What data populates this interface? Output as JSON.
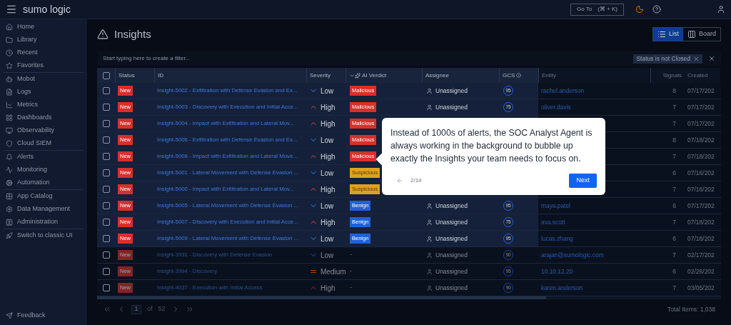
{
  "topbar": {
    "logo": "sumo logic",
    "goto_label": "Go To",
    "goto_shortcut": "(⌘ + K)"
  },
  "sidebar": {
    "groups": [
      [
        {
          "label": "Home"
        },
        {
          "label": "Library"
        },
        {
          "label": "Recent"
        },
        {
          "label": "Favorites"
        }
      ],
      [
        {
          "label": "Mobot"
        },
        {
          "label": "Logs"
        },
        {
          "label": "Metrics"
        },
        {
          "label": "Dashboards"
        },
        {
          "label": "Observability"
        },
        {
          "label": "Cloud SIEM"
        }
      ],
      [
        {
          "label": "Alerts"
        },
        {
          "label": "Monitoring"
        },
        {
          "label": "Automation"
        }
      ],
      [
        {
          "label": "App Catalog"
        },
        {
          "label": "Data Management"
        },
        {
          "label": "Administration"
        }
      ],
      [
        {
          "label": "Switch to classic UI"
        }
      ]
    ],
    "feedback": "Feedback"
  },
  "page": {
    "title": "Insights",
    "views": [
      {
        "label": "List",
        "selected": true
      },
      {
        "label": "Board",
        "selected": false
      }
    ]
  },
  "filter": {
    "placeholder": "Start typing here to create a filter...",
    "chips": [
      "Status is not Closed"
    ]
  },
  "table": {
    "select_all": {
      "checked": false
    },
    "columns": [
      "Status",
      "ID",
      "Severity",
      "AI Verdict",
      "Assignee",
      "GCS",
      "Entity",
      "Signals",
      "Created"
    ],
    "rows": [
      {
        "checked": false,
        "dimmed": false,
        "status": "New",
        "id": "Insight-5002 - Exfiltration with Defense Evasion and Ex...",
        "severity": {
          "kind": "low",
          "label": "Low"
        },
        "verdict": {
          "kind": "malicious",
          "label": "Malicious"
        },
        "assignee": "Unassigned",
        "gcs": "95",
        "entity": "rachel.anderson",
        "signals": "8",
        "created": "07/17/202"
      },
      {
        "checked": false,
        "dimmed": false,
        "status": "New",
        "id": "Insight-5003 - Discovery with Execution and Initial Acce...",
        "severity": {
          "kind": "high",
          "label": "High"
        },
        "verdict": {
          "kind": "malicious",
          "label": "Malicious"
        },
        "assignee": "Unassigned",
        "gcs": "75",
        "entity": "oliver.davis",
        "signals": "7",
        "created": "07/17/202"
      },
      {
        "checked": false,
        "dimmed": false,
        "status": "New",
        "id": "Insight-5004 - Impact with Exfiltration and Lateral Mov...",
        "severity": {
          "kind": "high",
          "label": "High"
        },
        "verdict": {
          "kind": "malicious",
          "label": "Malicious"
        },
        "signals": "7",
        "created": "07/17/202"
      },
      {
        "checked": false,
        "dimmed": false,
        "status": "New",
        "id": "Insight-5006 - Exfiltration with Defense Evasion and Ex...",
        "severity": {
          "kind": "low",
          "label": "Low"
        },
        "verdict": {
          "kind": "malicious",
          "label": "Malicious"
        },
        "signals": "8",
        "created": "07/18/202"
      },
      {
        "checked": false,
        "dimmed": false,
        "status": "New",
        "id": "Insight-5008 - Impact with Exfiltration and Lateral Move...",
        "severity": {
          "kind": "high",
          "label": "High"
        },
        "verdict": {
          "kind": "malicious",
          "label": "Malicious"
        },
        "signals": "7",
        "created": "07/18/202"
      },
      {
        "checked": false,
        "dimmed": false,
        "status": "New",
        "id": "Insight-5001 - Lateral Movement with Defense Evasion ...",
        "severity": {
          "kind": "low",
          "label": "Low"
        },
        "verdict": {
          "kind": "suspicious",
          "label": "Suspicious"
        },
        "signals": "6",
        "created": "07/16/202"
      },
      {
        "checked": false,
        "dimmed": false,
        "status": "New",
        "id": "Insight-5000 - Impact with Exfiltration and Lateral Mov...",
        "severity": {
          "kind": "high",
          "label": "High"
        },
        "verdict": {
          "kind": "suspicious",
          "label": "Suspicious"
        },
        "signals": "7",
        "created": "07/16/202"
      },
      {
        "checked": false,
        "dimmed": false,
        "status": "New",
        "id": "Insight-5005 - Lateral Movement with Defense Evasion ...",
        "severity": {
          "kind": "low",
          "label": "Low"
        },
        "verdict": {
          "kind": "benign",
          "label": "Benign"
        },
        "assignee": "Unassigned",
        "gcs": "95",
        "entity": "maya.patel",
        "signals": "6",
        "created": "07/17/202"
      },
      {
        "checked": false,
        "dimmed": false,
        "status": "New",
        "id": "Insight-5007 - Discovery with Execution and Initial Acce...",
        "severity": {
          "kind": "high",
          "label": "High"
        },
        "verdict": {
          "kind": "benign",
          "label": "Benign"
        },
        "assignee": "Unassigned",
        "gcs": "75",
        "entity": "ava.scott",
        "signals": "7",
        "created": "07/18/202"
      },
      {
        "checked": false,
        "dimmed": false,
        "status": "New",
        "id": "Insight-5009 - Lateral Movement with Defense Evasion ...",
        "severity": {
          "kind": "low",
          "label": "Low"
        },
        "verdict": {
          "kind": "benign",
          "label": "Benign"
        },
        "assignee": "Unassigned",
        "gcs": "95",
        "entity": "lucas.zhang",
        "signals": "6",
        "created": "07/18/202"
      },
      {
        "checked": false,
        "dimmed": true,
        "status": "New",
        "id": "Insight-3931 - Discovery with Defense Evasion",
        "severity": {
          "kind": "low",
          "label": "Low"
        },
        "verdict": {
          "kind": "none",
          "label": "-"
        },
        "assignee": "Unassigned",
        "gcs": "90",
        "entity": "arajan@sumologic.com",
        "signals": "7",
        "created": "02/17/202"
      },
      {
        "checked": false,
        "dimmed": true,
        "status": "New",
        "id": "Insight-3994 - Discovery",
        "severity": {
          "kind": "medium",
          "label": "Medium"
        },
        "verdict": {
          "kind": "none",
          "label": "-"
        },
        "assignee": "Unassigned",
        "gcs": "95",
        "entity": "10.10.12.20",
        "signals": "6",
        "created": "02/26/202"
      },
      {
        "checked": false,
        "dimmed": true,
        "status": "New",
        "id": "Insight-4037 - Execution with Initial Access",
        "severity": {
          "kind": "high",
          "label": "High"
        },
        "verdict": {
          "kind": "none",
          "label": "-"
        },
        "assignee": "Unassigned",
        "gcs": "90",
        "entity": "karen.anderson",
        "signals": "7",
        "created": "03/05/202"
      }
    ]
  },
  "pagination": {
    "page": "1",
    "of": "of",
    "total_pages": "52",
    "total_items": "Total Items: 1,038"
  },
  "tour": {
    "text": "Instead of 1000s of alerts, the SOC Analyst Agent is always working in the background to bubble up exactly the Insights your team needs to focus on.",
    "step": "2/14",
    "next": "Next"
  }
}
